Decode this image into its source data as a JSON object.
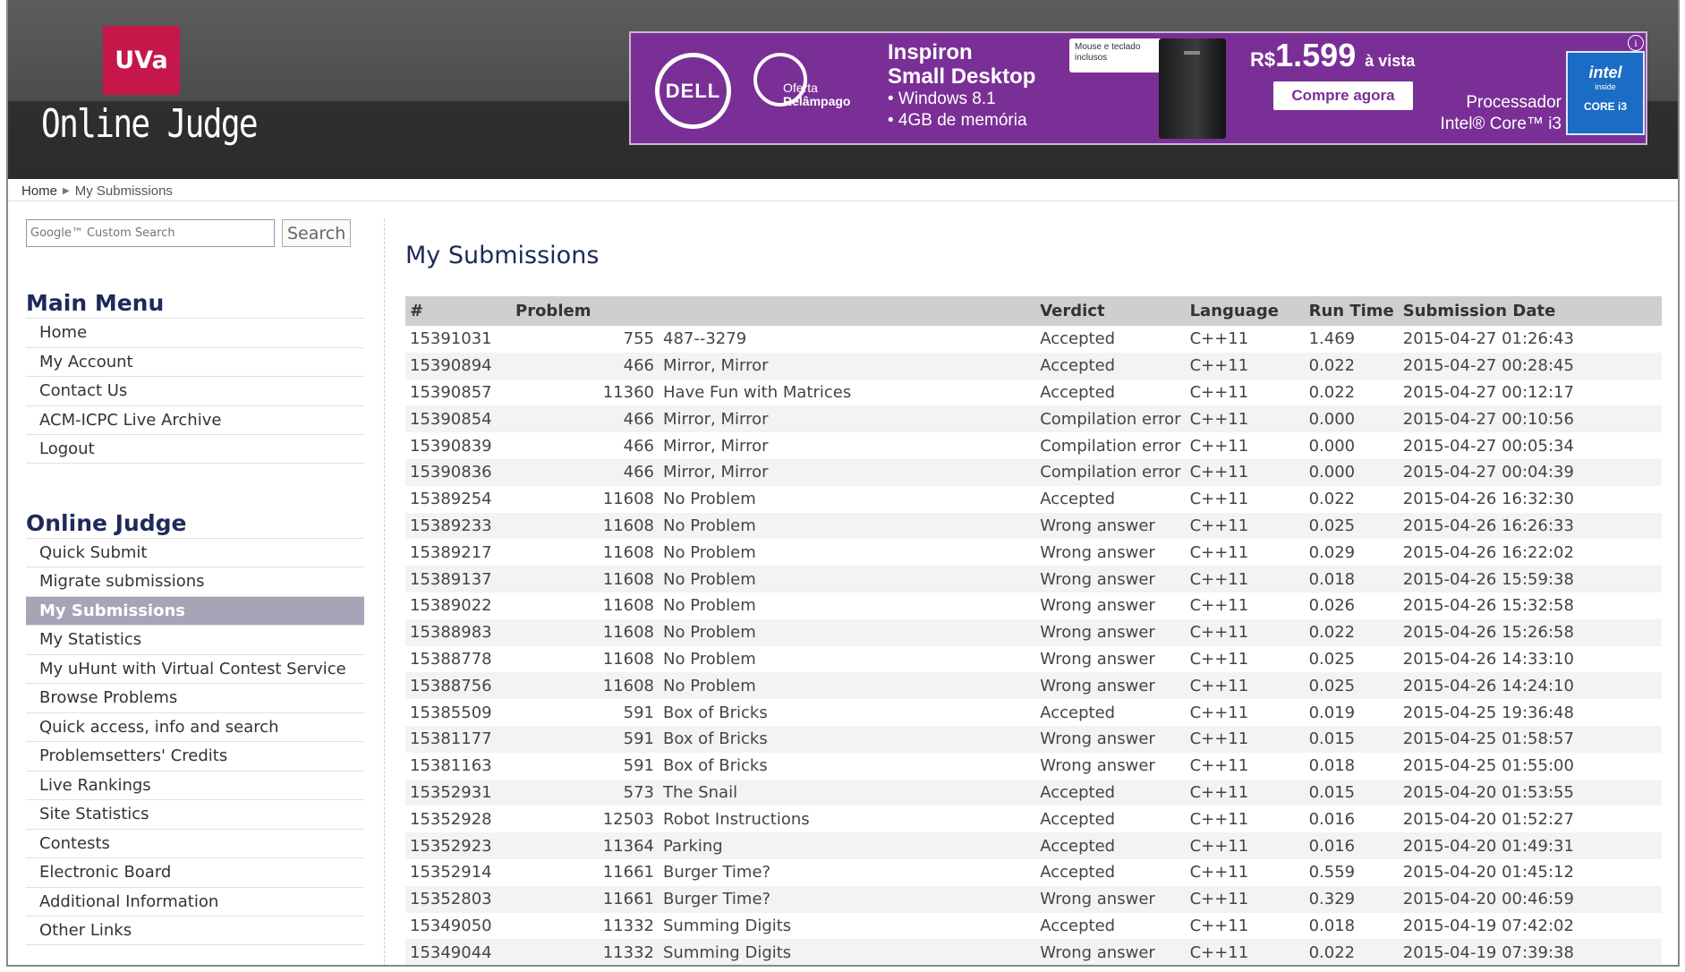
{
  "logo": {
    "text": "UVa"
  },
  "site_title": "Online Judge",
  "ad": {
    "brand": "DELL",
    "oferta_line1": "Oferta",
    "oferta_line2": "Relâmpago",
    "headline_line1": "Inspiron",
    "headline_line2": "Small Desktop",
    "bullet1": "• Windows 8.1",
    "bullet2": "• 4GB de memória",
    "keyboard_note": "Mouse e teclado inclusos",
    "price_prefix": "R$",
    "price": "1.599",
    "price_suffix": "à vista",
    "cta": "Compre agora",
    "processor_line1": "Processador",
    "processor_line2": "Intel® Core™ i3",
    "intel_brand": "intel",
    "intel_inside": "inside",
    "intel_model": "CORE i3",
    "info": "i"
  },
  "breadcrumb": {
    "home": "Home",
    "separator": "▶",
    "current": "My Submissions"
  },
  "search": {
    "placeholder": "Google™ Custom Search",
    "button": "Search"
  },
  "main_menu": {
    "title": "Main Menu",
    "items": [
      "Home",
      "My Account",
      "Contact Us",
      "ACM-ICPC Live Archive",
      "Logout"
    ]
  },
  "judge_menu": {
    "title": "Online Judge",
    "items": [
      "Quick Submit",
      "Migrate submissions",
      "My Submissions",
      "My Statistics",
      "My uHunt with Virtual Contest Service",
      "Browse Problems",
      "Quick access, info and search",
      "Problemsetters' Credits",
      "Live Rankings",
      "Site Statistics",
      "Contests",
      "Electronic Board",
      "Additional Information",
      "Other Links"
    ],
    "active_index": 2
  },
  "page_title": "My Submissions",
  "table": {
    "headers": [
      "#",
      "Problem",
      "Verdict",
      "Language",
      "Run Time",
      "Submission Date"
    ],
    "rows": [
      [
        "15391031",
        "755",
        "487--3279",
        "Accepted",
        "C++11",
        "1.469",
        "2015-04-27 01:26:43"
      ],
      [
        "15390894",
        "466",
        "Mirror, Mirror",
        "Accepted",
        "C++11",
        "0.022",
        "2015-04-27 00:28:45"
      ],
      [
        "15390857",
        "11360",
        "Have Fun with Matrices",
        "Accepted",
        "C++11",
        "0.022",
        "2015-04-27 00:12:17"
      ],
      [
        "15390854",
        "466",
        "Mirror, Mirror",
        "Compilation error",
        "C++11",
        "0.000",
        "2015-04-27 00:10:56"
      ],
      [
        "15390839",
        "466",
        "Mirror, Mirror",
        "Compilation error",
        "C++11",
        "0.000",
        "2015-04-27 00:05:34"
      ],
      [
        "15390836",
        "466",
        "Mirror, Mirror",
        "Compilation error",
        "C++11",
        "0.000",
        "2015-04-27 00:04:39"
      ],
      [
        "15389254",
        "11608",
        "No Problem",
        "Accepted",
        "C++11",
        "0.022",
        "2015-04-26 16:32:30"
      ],
      [
        "15389233",
        "11608",
        "No Problem",
        "Wrong answer",
        "C++11",
        "0.025",
        "2015-04-26 16:26:33"
      ],
      [
        "15389217",
        "11608",
        "No Problem",
        "Wrong answer",
        "C++11",
        "0.029",
        "2015-04-26 16:22:02"
      ],
      [
        "15389137",
        "11608",
        "No Problem",
        "Wrong answer",
        "C++11",
        "0.018",
        "2015-04-26 15:59:38"
      ],
      [
        "15389022",
        "11608",
        "No Problem",
        "Wrong answer",
        "C++11",
        "0.026",
        "2015-04-26 15:32:58"
      ],
      [
        "15388983",
        "11608",
        "No Problem",
        "Wrong answer",
        "C++11",
        "0.022",
        "2015-04-26 15:26:58"
      ],
      [
        "15388778",
        "11608",
        "No Problem",
        "Wrong answer",
        "C++11",
        "0.025",
        "2015-04-26 14:33:10"
      ],
      [
        "15388756",
        "11608",
        "No Problem",
        "Wrong answer",
        "C++11",
        "0.025",
        "2015-04-26 14:24:10"
      ],
      [
        "15385509",
        "591",
        "Box of Bricks",
        "Accepted",
        "C++11",
        "0.019",
        "2015-04-25 19:36:48"
      ],
      [
        "15381177",
        "591",
        "Box of Bricks",
        "Wrong answer",
        "C++11",
        "0.015",
        "2015-04-25 01:58:57"
      ],
      [
        "15381163",
        "591",
        "Box of Bricks",
        "Wrong answer",
        "C++11",
        "0.018",
        "2015-04-25 01:55:00"
      ],
      [
        "15352931",
        "573",
        "The Snail",
        "Accepted",
        "C++11",
        "0.015",
        "2015-04-20 01:53:55"
      ],
      [
        "15352928",
        "12503",
        "Robot Instructions",
        "Accepted",
        "C++11",
        "0.016",
        "2015-04-20 01:52:27"
      ],
      [
        "15352923",
        "11364",
        "Parking",
        "Accepted",
        "C++11",
        "0.016",
        "2015-04-20 01:49:31"
      ],
      [
        "15352914",
        "11661",
        "Burger Time?",
        "Accepted",
        "C++11",
        "0.559",
        "2015-04-20 01:45:12"
      ],
      [
        "15352803",
        "11661",
        "Burger Time?",
        "Wrong answer",
        "C++11",
        "0.329",
        "2015-04-20 00:46:59"
      ],
      [
        "15349050",
        "11332",
        "Summing Digits",
        "Accepted",
        "C++11",
        "0.018",
        "2015-04-19 07:42:02"
      ],
      [
        "15349044",
        "11332",
        "Summing Digits",
        "Wrong answer",
        "C++11",
        "0.022",
        "2015-04-19 07:39:38"
      ]
    ]
  },
  "colors": {
    "accent": "#c5174a",
    "link": "#a01f1f",
    "heading": "#1d2a5a",
    "active_menu": "#a6a5b8",
    "ad_bg": "#7a2f96",
    "error": "#b02020"
  }
}
